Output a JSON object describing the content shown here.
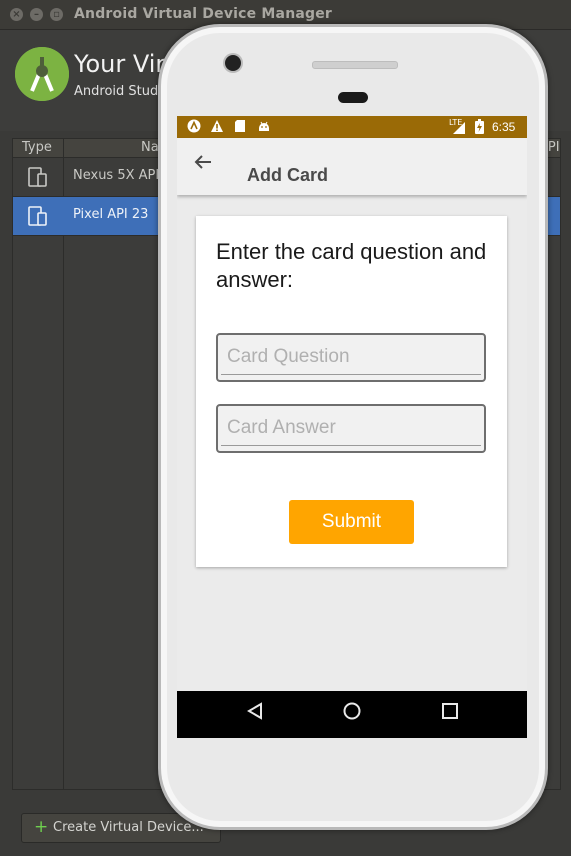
{
  "window": {
    "title": "Android Virtual Device Manager",
    "controls": [
      "close",
      "minimize",
      "maximize"
    ]
  },
  "header": {
    "title": "Your Virtual Devices",
    "subtitle": "Android Studio"
  },
  "table": {
    "columns": [
      "Type",
      "Name",
      "API"
    ],
    "rows": [
      {
        "type_icon": "phone-tablet-icon",
        "name": "Nexus 5X API",
        "selected": false
      },
      {
        "type_icon": "phone-tablet-icon",
        "name": "Pixel API 23",
        "selected": true
      }
    ]
  },
  "footer": {
    "create_label": "Create Virtual Device..."
  },
  "phone": {
    "status_bar": {
      "left_icons": [
        "android-a-icon",
        "warning-icon",
        "sd-card-icon",
        "android-debug-icon"
      ],
      "network": "LTE",
      "time": "6:35",
      "color": "#9a6a06"
    },
    "app_bar": {
      "title": "Add Card"
    },
    "form": {
      "prompt": "Enter the card question and answer:",
      "question_placeholder": "Card Question",
      "answer_placeholder": "Card Answer",
      "submit_label": "Submit",
      "submit_color": "#ffa500"
    },
    "nav_bar": [
      "back-icon",
      "home-icon",
      "recents-icon"
    ]
  }
}
